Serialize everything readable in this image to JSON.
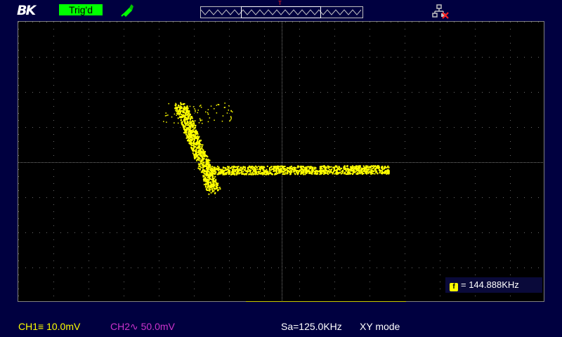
{
  "header": {
    "logo": "BK",
    "trigger_status": "Trig'd",
    "probe_icon": "probe-icon",
    "network_icon": "network-disconnected-icon",
    "trigger_marker": "T"
  },
  "display": {
    "frequency_label": "= 144.888KHz",
    "frequency_icon": "f"
  },
  "status": {
    "ch1": "CH1≡ 10.0mV",
    "ch2": "CH2∿ 50.0mV",
    "sample_rate": "Sa=125.0KHz",
    "mode": "XY mode"
  },
  "colors": {
    "trace": "#ffff00",
    "ch1": "#ffff00",
    "ch2": "#cc33cc",
    "trig_bg": "#00ff00",
    "background": "#000040"
  }
}
